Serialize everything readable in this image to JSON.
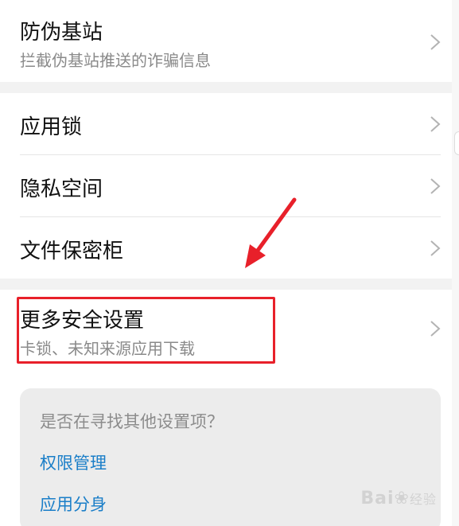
{
  "section_top": {
    "items": [
      {
        "title": "防伪基站",
        "subtitle": "拦截伪基站推送的诈骗信息"
      }
    ]
  },
  "section_mid": {
    "items": [
      {
        "title": "应用锁"
      },
      {
        "title": "隐私空间"
      },
      {
        "title": "文件保密柜"
      }
    ]
  },
  "section_more": {
    "title": "更多安全设置",
    "subtitle": "卡锁、未知来源应用下载"
  },
  "suggestions": {
    "title": "是否在寻找其他设置项？",
    "links": [
      "权限管理",
      "应用分身"
    ]
  },
  "watermark": {
    "brand": "Bai",
    "suffix": "经验"
  },
  "colors": {
    "highlight": "#e8202a",
    "link": "#1a7ec8",
    "background": "#f2f2f2"
  }
}
